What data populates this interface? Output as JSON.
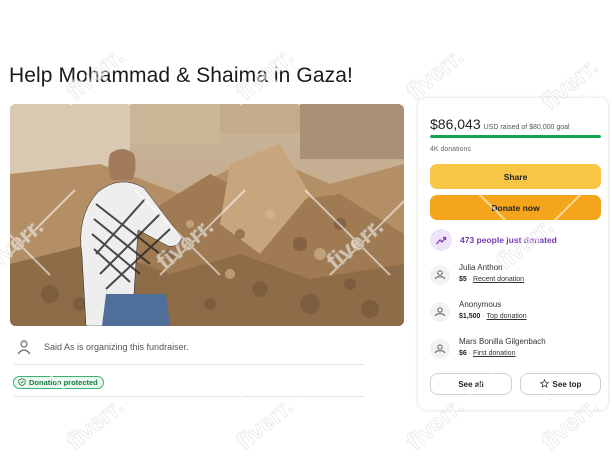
{
  "campaign": {
    "title": "Help Mohammad & Shaima in Gaza!",
    "organizer_text": "Said As is organizing this fundraiser.",
    "protected_label": "Donation protected"
  },
  "sidebar": {
    "raised_amount": "$86,043",
    "raised_suffix": "USD raised of $80,000 goal",
    "progress_fraction": 1.0,
    "donations_count": "4K donations",
    "share_label": "Share",
    "donate_label": "Donate now",
    "recent_activity": "473 people just donated",
    "donors": [
      {
        "name": "Julia Anthon",
        "amount": "$5",
        "tag": "Recent donation"
      },
      {
        "name": "Anonymous",
        "amount": "$1,500",
        "tag": "Top donation"
      },
      {
        "name": "Mars Bonilla Gilgenbach",
        "amount": "$6",
        "tag": "First donation"
      }
    ],
    "see_all_label": "See all",
    "see_top_label": "See top"
  },
  "watermark": {
    "text": "fiverr."
  },
  "colors": {
    "progress": "#14a44d",
    "share": "#f7c644",
    "donate": "#f4a51c",
    "recent_purple": "#7a3ab7",
    "protected_green": "#3cb371"
  },
  "icons": [
    "user-icon",
    "shield-check-icon",
    "trend-up-icon",
    "donor-hands-icon",
    "star-icon"
  ]
}
